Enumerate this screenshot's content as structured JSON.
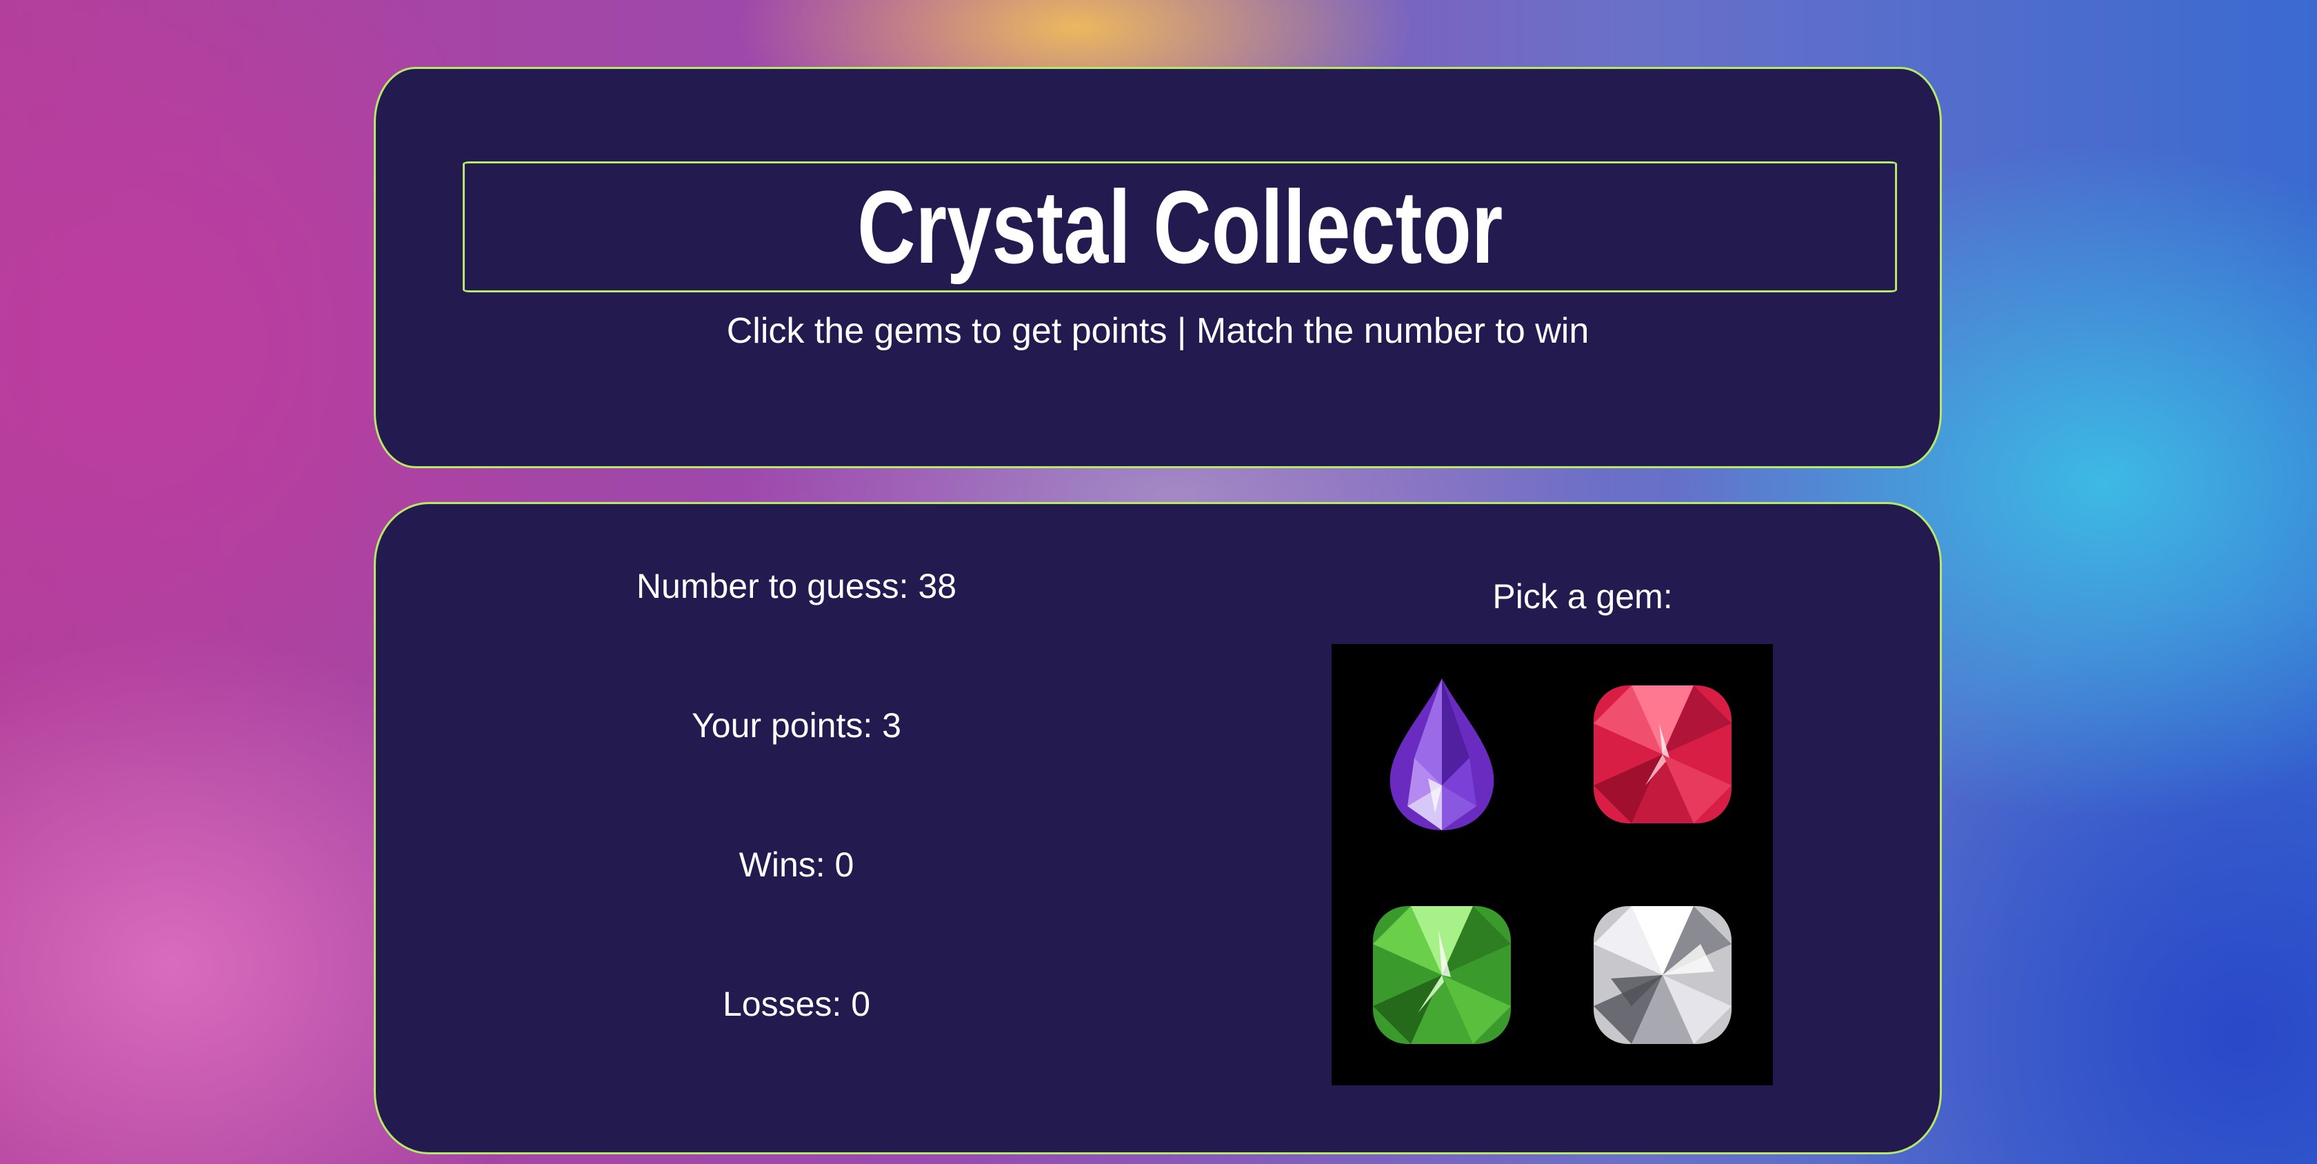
{
  "header": {
    "title": "Crystal Collector",
    "subtitle": "Click the gems to get points | Match the number to win"
  },
  "stats": {
    "number_to_guess": "Number to guess: 38",
    "your_points": "Your points: 3",
    "wins": "Wins: 0",
    "losses": "Losses: 0"
  },
  "gems": {
    "label": "Pick a gem:",
    "items": [
      {
        "name": "purple-gem",
        "color": "#7a3ad0"
      },
      {
        "name": "red-gem",
        "color": "#e0244a"
      },
      {
        "name": "green-gem",
        "color": "#4ab03a"
      },
      {
        "name": "white-gem",
        "color": "#d8d8dc"
      }
    ]
  },
  "colors": {
    "panel": "#231a4f",
    "border": "#b8e86a",
    "text": "#ffffff"
  }
}
